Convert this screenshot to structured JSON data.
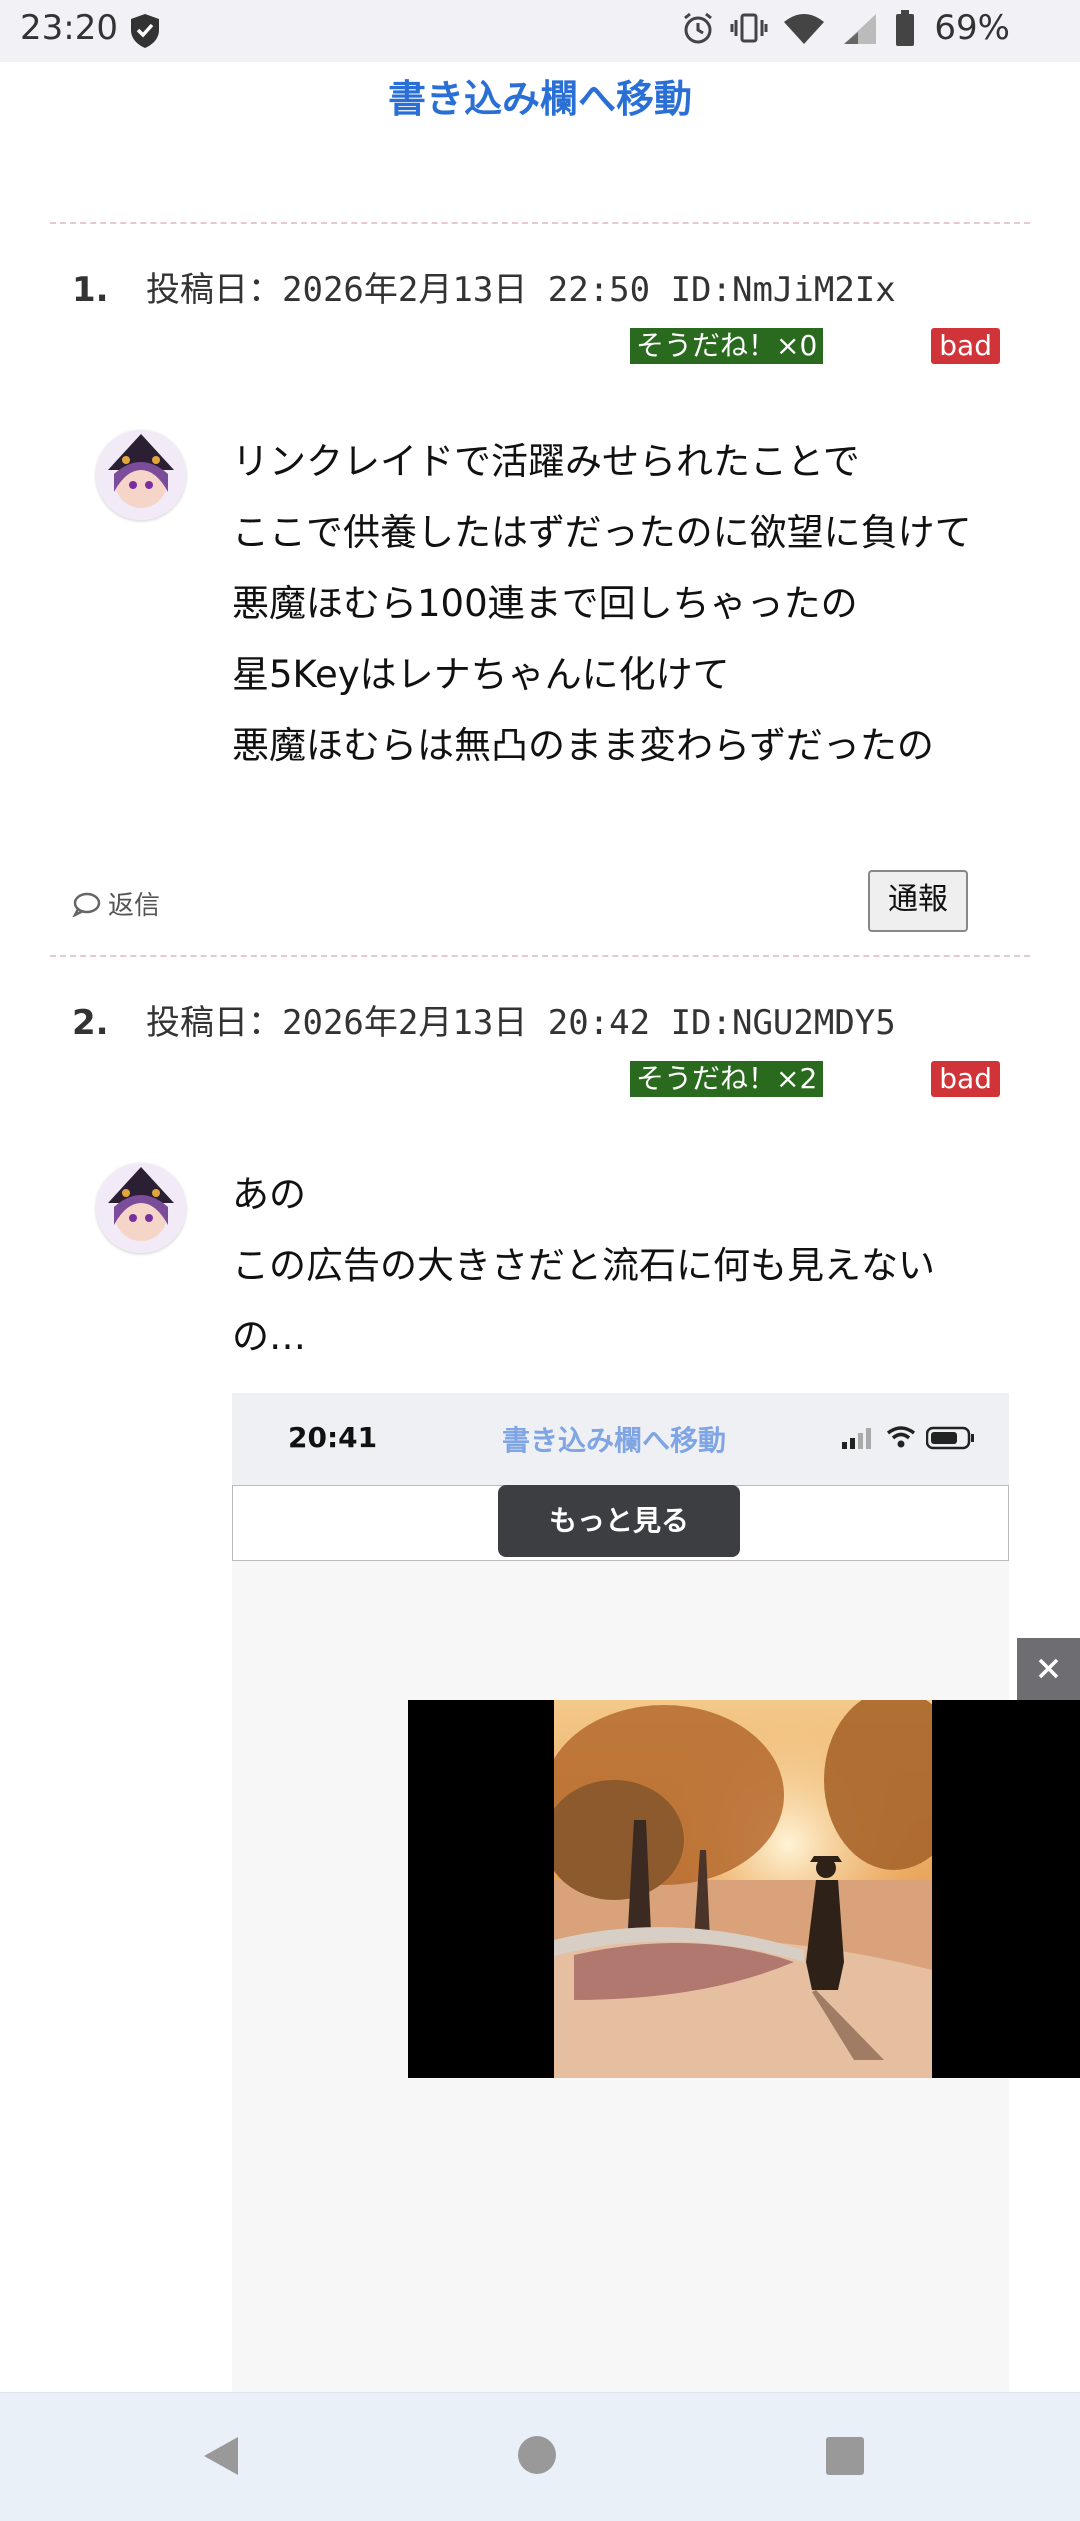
{
  "status_bar": {
    "time": "23:20",
    "battery": "69%"
  },
  "header": {
    "jump_link": "書き込み欄へ移動"
  },
  "posts": [
    {
      "number": "1.",
      "meta": "投稿日：2026年2月13日 22:50 ID:NmJiM2Ix",
      "good": "そうだね！×0",
      "bad": "bad",
      "lines": [
        "リンクレイドで活躍みせられたことで",
        "ここで供養したはずだったのに欲望に負けて",
        "悪魔ほむら100連まで回しちゃったの",
        "星5Keyはレナちゃんに化けて",
        "悪魔ほむらは無凸のまま変わらずだったの"
      ],
      "reply": "返信",
      "report": "通報"
    },
    {
      "number": "2.",
      "meta": "投稿日：2026年2月13日 20:42 ID:NGU2MDY5",
      "good": "そうだね！×2",
      "bad": "bad",
      "lines": [
        "あの",
        "この広告の大きさだと流石に何も見えない",
        "の…"
      ]
    }
  ],
  "embedded_screenshot": {
    "time": "20:41",
    "jump_link": "書き込み欄へ移動",
    "more_button": "もっと見る"
  },
  "ad": {
    "close": "✕"
  },
  "colors": {
    "accent": "#2a6fd6",
    "good_badge": "#2a6a1e",
    "bad_badge": "#d13438"
  }
}
